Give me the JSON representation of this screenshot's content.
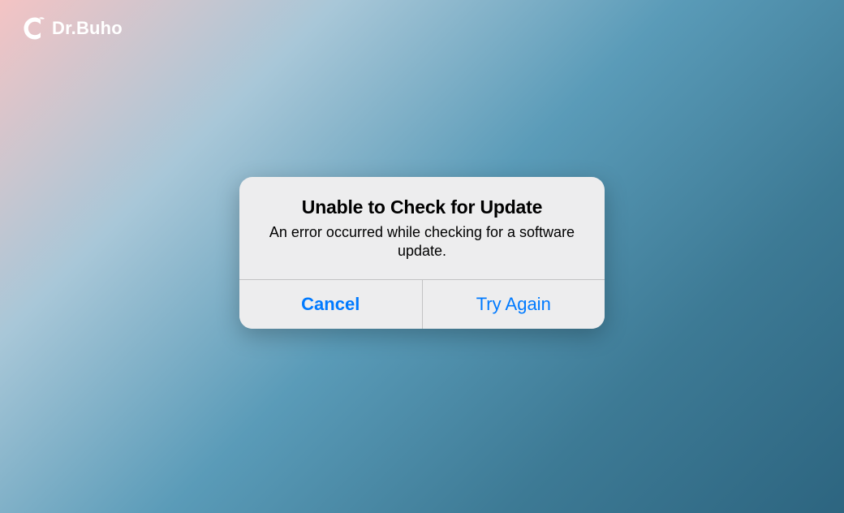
{
  "brand": {
    "name": "Dr.Buho",
    "icon": "owl-c-icon"
  },
  "dialog": {
    "title": "Unable to Check for Update",
    "message": "An error occurred while checking for a software update.",
    "buttons": {
      "cancel": "Cancel",
      "retry": "Try Again"
    }
  }
}
